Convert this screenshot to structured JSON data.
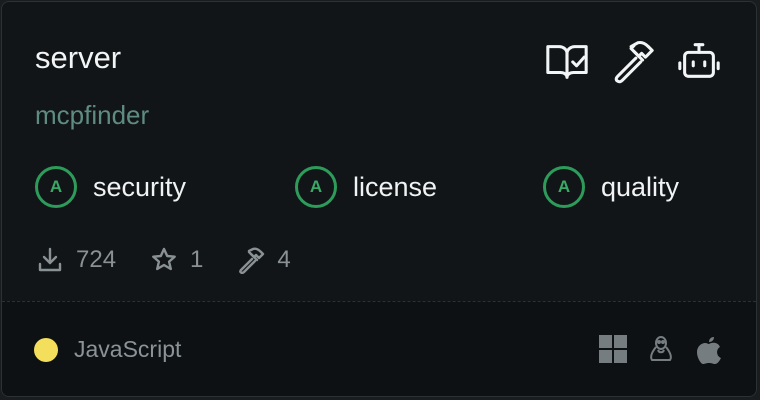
{
  "card": {
    "title": "server",
    "author": "mcpfinder",
    "header_icons": [
      "docs-check-icon",
      "hammer-icon",
      "bot-icon"
    ],
    "scores": [
      {
        "grade": "A",
        "label": "security"
      },
      {
        "grade": "A",
        "label": "license"
      },
      {
        "grade": "A",
        "label": "quality"
      }
    ],
    "stats": {
      "downloads": "724",
      "stars": "1",
      "tools": "4"
    },
    "language": {
      "name": "JavaScript",
      "color": "#f3df5b"
    },
    "platforms": [
      "windows-icon",
      "linux-icon",
      "apple-icon"
    ]
  },
  "colors": {
    "background": "#111517",
    "accent_green": "#2d9b5a",
    "muted_text": "#8a9194",
    "author_text": "#5f8c80"
  }
}
